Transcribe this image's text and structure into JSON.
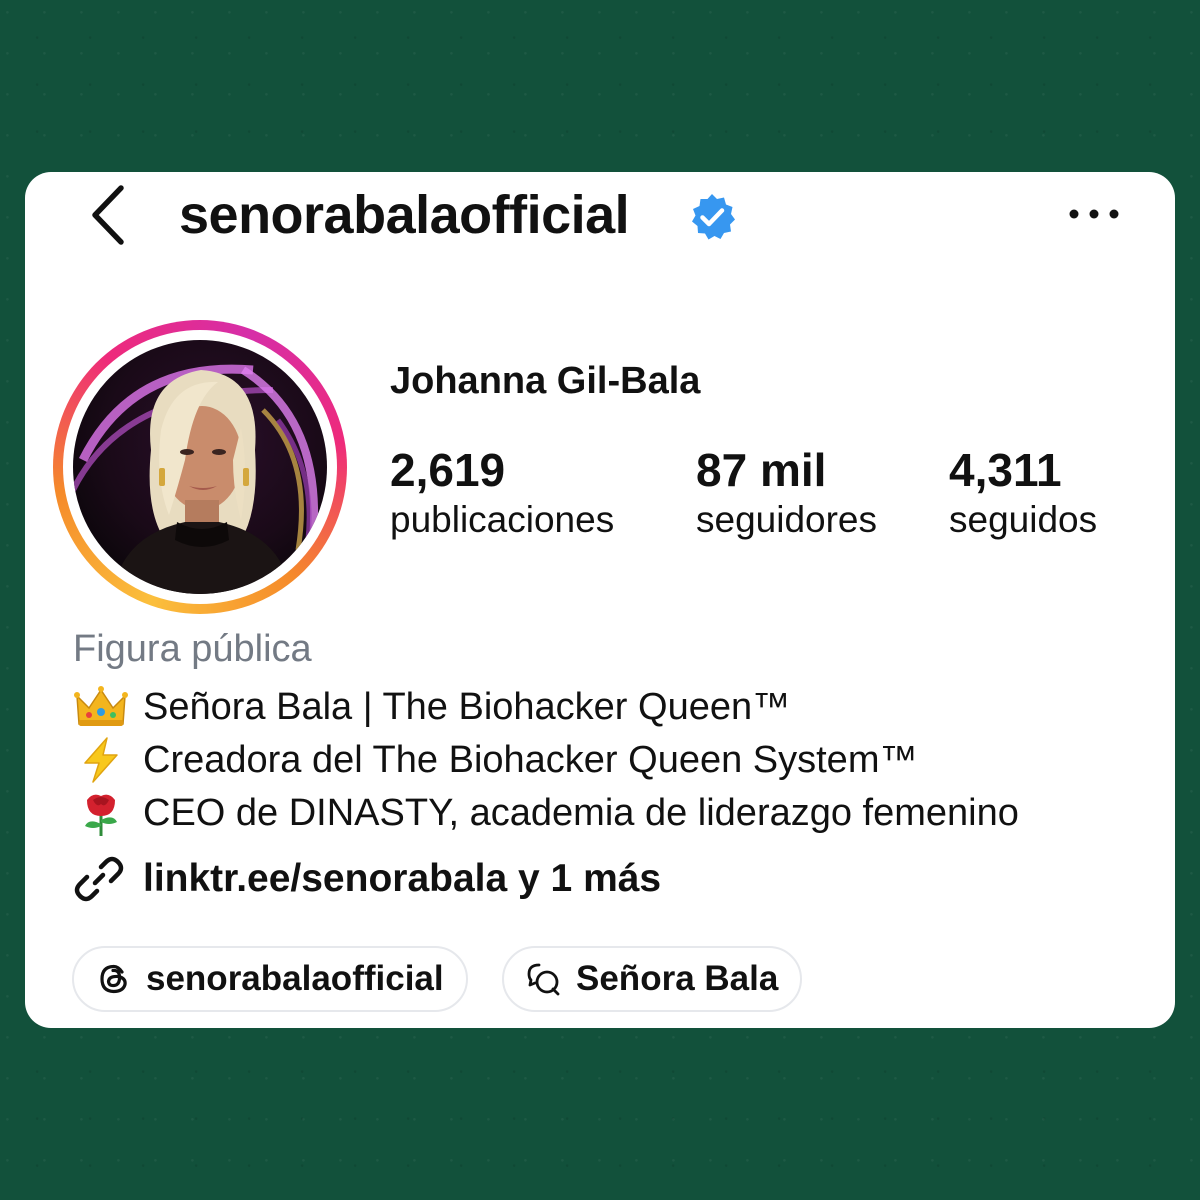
{
  "header": {
    "back_icon": "chevron-left-icon",
    "username": "senorabalaofficial",
    "verified_icon": "verified-badge-icon",
    "more_icon": "more-horizontal-icon"
  },
  "profile": {
    "display_name": "Johanna Gil-Bala",
    "stats": [
      {
        "value": "2,619",
        "label": "publicaciones"
      },
      {
        "value": "87 mil",
        "label": "seguidores"
      },
      {
        "value": "4,311",
        "label": "seguidos"
      }
    ],
    "category": "Figura pública",
    "bio": [
      {
        "icon": "crown-emoji",
        "text": "Señora Bala | The Biohacker Queen™"
      },
      {
        "icon": "lightning-emoji",
        "text": "Creadora del The Biohacker Queen System™"
      },
      {
        "icon": "rose-emoji",
        "text": "CEO de DINASTY, academia de liderazgo femenino"
      }
    ],
    "link": {
      "icon": "link-icon",
      "text": "linktr.ee/senorabala y 1 más"
    },
    "chips": [
      {
        "icon": "threads-icon",
        "label": "senorabalaofficial"
      },
      {
        "icon": "messenger-chat-icon",
        "label": "Señora Bala"
      }
    ]
  },
  "colors": {
    "background": "#12513b",
    "verified_blue": "#3797f0",
    "muted_text": "#737a84"
  }
}
